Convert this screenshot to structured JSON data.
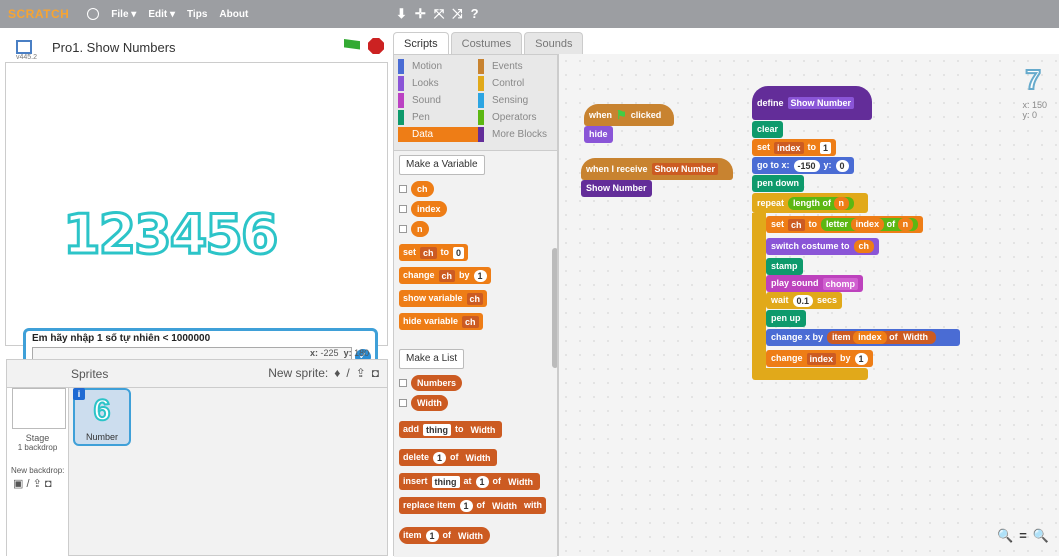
{
  "topbar": {
    "logo": "SCRATCH",
    "menus": [
      "File ▾",
      "Edit ▾",
      "Tips",
      "About"
    ],
    "tools": [
      "⬇",
      "✛",
      "⤧",
      "⤨",
      "?"
    ]
  },
  "stage": {
    "version": "v445.2",
    "title": "Pro1. Show Numbers",
    "display_number": "123456",
    "ask_prompt": "Em hãy nhập 1 số tự nhiên < 1000000",
    "ask_value": "",
    "mouse_x": "-225",
    "mouse_y": "180"
  },
  "sprites_panel": {
    "heading": "Sprites",
    "new_sprite_label": "New sprite:",
    "stage_label": "Stage",
    "backdrop_count": "1 backdrop",
    "new_backdrop_label": "New backdrop:",
    "sprite_costume_char": "6",
    "sprite_name": "Number"
  },
  "tabs": [
    "Scripts",
    "Costumes",
    "Sounds"
  ],
  "categories": [
    {
      "label": "Motion",
      "color": "#4a6cd4"
    },
    {
      "label": "Events",
      "color": "#c88330"
    },
    {
      "label": "Looks",
      "color": "#8a55d7"
    },
    {
      "label": "Control",
      "color": "#e1a91a"
    },
    {
      "label": "Sound",
      "color": "#bb42c3"
    },
    {
      "label": "Sensing",
      "color": "#2ca5e2"
    },
    {
      "label": "Pen",
      "color": "#0e9a6c"
    },
    {
      "label": "Operators",
      "color": "#5cb712"
    },
    {
      "label": "Data",
      "color": "#ee7d16"
    },
    {
      "label": "More Blocks",
      "color": "#632d99"
    }
  ],
  "palette": {
    "make_variable": "Make a Variable",
    "variables": [
      "ch",
      "index",
      "n"
    ],
    "set_block": {
      "label": "set",
      "var": "ch",
      "to": "to",
      "value": "0"
    },
    "change_block": {
      "label": "change",
      "var": "ch",
      "by": "by",
      "value": "1"
    },
    "show_var": {
      "label": "show variable",
      "var": "ch"
    },
    "hide_var": {
      "label": "hide variable",
      "var": "ch"
    },
    "make_list": "Make a List",
    "lists": [
      "Numbers",
      "Width"
    ],
    "add_block": {
      "label": "add",
      "thing": "thing",
      "to": "to",
      "list": "Width"
    },
    "delete_block": {
      "label": "delete",
      "idx": "1",
      "of": "of",
      "list": "Width"
    },
    "insert_block": {
      "label": "insert",
      "thing": "thing",
      "at": "at",
      "idx": "1",
      "of": "of",
      "list": "Width"
    },
    "replace_block": {
      "label": "replace item",
      "idx": "1",
      "of": "of",
      "list": "Width",
      "with": "with"
    },
    "item_block": {
      "label": "item",
      "idx": "1",
      "of": "of",
      "list": "Width"
    }
  },
  "scripts": {
    "s1_hat": "when",
    "s1_clicked": "clicked",
    "s1_hide": "hide",
    "s2_hat": "when I receive",
    "s2_msg": "Show Number",
    "s2_call": "Show Number",
    "define": "define",
    "define_name": "Show Number",
    "clear": "clear",
    "set_index": {
      "label": "set",
      "var": "index",
      "to": "to",
      "value": "1"
    },
    "goto": {
      "label": "go to x:",
      "x": "-150",
      "ylabel": "y:",
      "y": "0"
    },
    "pen_down": "pen down",
    "repeat": {
      "label": "repeat",
      "length": "length of",
      "var": "n"
    },
    "set_ch": {
      "label": "set",
      "var": "ch",
      "to": "to",
      "letter": "letter",
      "idx": "index",
      "of": "of",
      "n": "n"
    },
    "switch_costume": {
      "label": "switch costume to",
      "var": "ch"
    },
    "stamp": "stamp",
    "play_sound": {
      "label": "play sound",
      "sound": "chomp"
    },
    "wait": {
      "label": "wait",
      "value": "0.1",
      "secs": "secs"
    },
    "pen_up": "pen up",
    "change_x": {
      "label": "change x by",
      "item": "item",
      "idx": "index",
      "of": "of",
      "list": "Width"
    },
    "change_index": {
      "label": "change",
      "var": "index",
      "by": "by",
      "value": "1"
    },
    "corner_costume": "7",
    "corner_x": "x: 150",
    "corner_y": "y: 0"
  }
}
